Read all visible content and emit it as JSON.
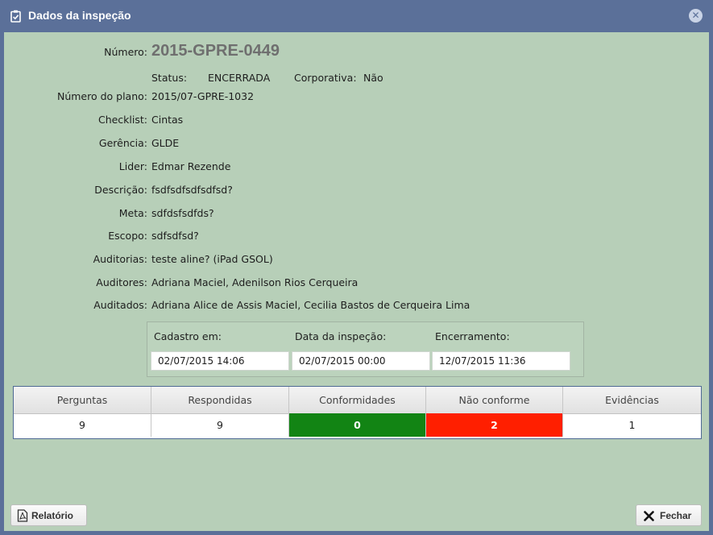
{
  "title": "Dados da inspeção",
  "fields": {
    "numero_label": "Número:",
    "numero": "2015-GPRE-0449",
    "status_label": "Status:",
    "status": "ENCERRADA",
    "corporativa_label": "Corporativa:",
    "corporativa": "Não",
    "plano_label": "Número do plano:",
    "plano": "2015/07-GPRE-1032",
    "checklist_label": "Checklist:",
    "checklist": "Cintas",
    "gerencia_label": "Gerência:",
    "gerencia": "GLDE",
    "lider_label": "Lider:",
    "lider": "Edmar Rezende",
    "descricao_label": "Descrição:",
    "descricao": "fsdfsdfsdfsdfsd?",
    "meta_label": "Meta:",
    "meta": "sdfdsfsdfds?",
    "escopo_label": "Escopo:",
    "escopo": "sdfsdfsd?",
    "auditorias_label": "Auditorias:",
    "auditorias": "teste aline? (iPad GSOL)",
    "auditores_label": "Auditores:",
    "auditores": "Adriana Maciel, Adenilson Rios Cerqueira",
    "auditados_label": "Auditados:",
    "auditados": "Adriana Alice de Assis Maciel, Cecilia Bastos de Cerqueira Lima"
  },
  "dates": {
    "cadastro_label": "Cadastro em:",
    "cadastro": "02/07/2015 14:06",
    "inspecao_label": "Data da inspeção:",
    "inspecao": "02/07/2015 00:00",
    "encerramento_label": "Encerramento:",
    "encerramento": "12/07/2015 11:36"
  },
  "stats": {
    "headers": [
      "Perguntas",
      "Respondidas",
      "Conformidades",
      "Não conforme",
      "Evidências"
    ],
    "values": [
      "9",
      "9",
      "0",
      "2",
      "1"
    ],
    "colors": {
      "conformidades": "#128414",
      "nao_conforme": "#ff1f00"
    }
  },
  "buttons": {
    "relatorio": "Relatório",
    "fechar": "Fechar"
  },
  "icons": {
    "title": "clipboard-check-icon",
    "close": "close-circle-icon",
    "relatorio": "pdf-icon",
    "fechar": "x-icon"
  }
}
